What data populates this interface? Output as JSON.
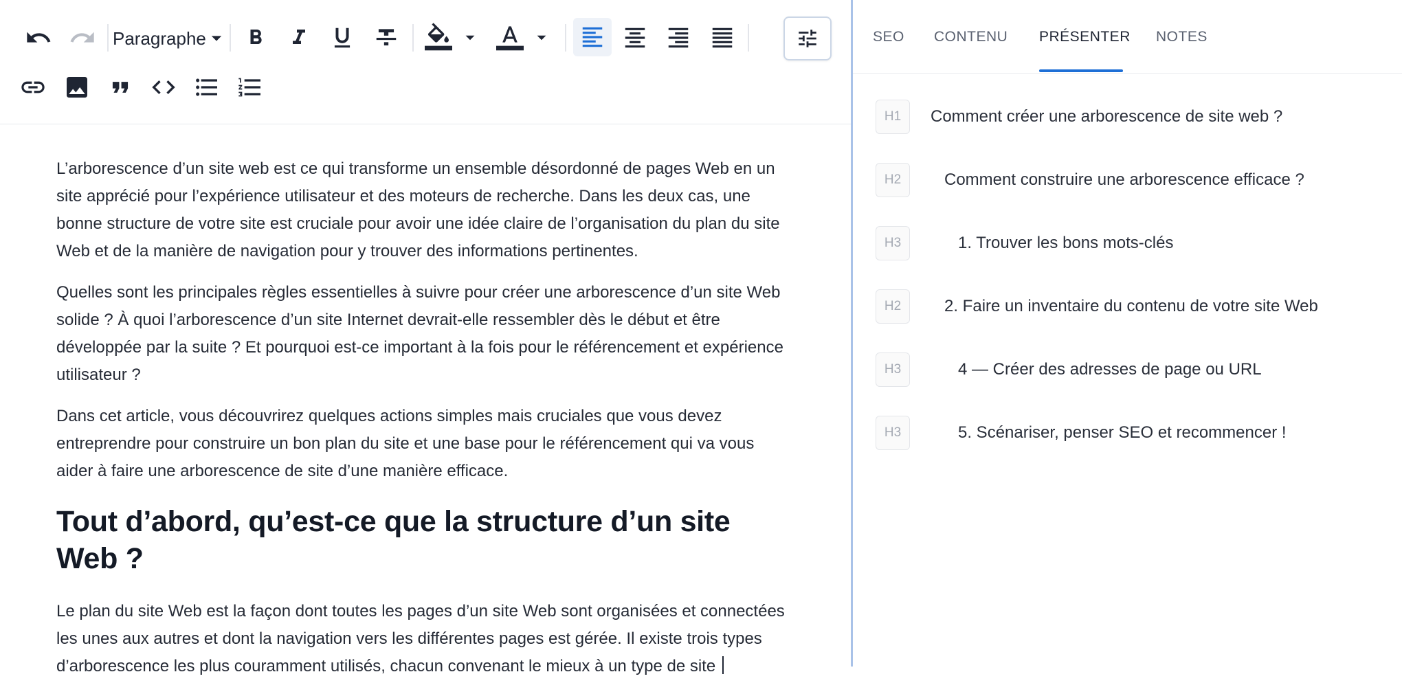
{
  "toolbar": {
    "block_format": "Paragraphe",
    "colors": {
      "highlight_fill": "#1f2533",
      "text_fill": "#1f2533",
      "accent": "#1e6fd6",
      "active_bg": "#eef2f8"
    },
    "icons": [
      "undo-icon",
      "redo-icon",
      "bold-icon",
      "italic-icon",
      "underline-icon",
      "strikethrough-icon",
      "highlight-color-icon",
      "text-color-icon",
      "align-left-icon",
      "align-center-icon",
      "align-right-icon",
      "align-justify-icon",
      "settings-sliders-icon",
      "link-icon",
      "image-icon",
      "quote-icon",
      "code-icon",
      "bullet-list-icon",
      "numbered-list-icon"
    ]
  },
  "editor": {
    "paragraphs": [
      "L’arborescence d’un site web est ce qui transforme un ensemble désordonné de pages Web en un site apprécié pour l’expérience utilisateur et des moteurs de recherche. Dans les deux cas, une bonne structure de votre site est cruciale pour avoir une idée claire de l’organisation du plan du site Web et de la manière de navigation pour y trouver des informations pertinentes.",
      "Quelles sont les principales règles essentielles à suivre pour créer une arborescence d’un site Web solide ? À quoi l’arborescence d’un site Internet devrait-elle ressembler dès le début et être développée par la suite ? Et pourquoi est-ce important à la fois pour le référencement et expérience utilisateur ?",
      "Dans cet article, vous découvrirez quelques actions simples mais cruciales que vous devez entreprendre pour construire un bon plan du site et une base pour le référencement qui va vous aider à faire une arborescence de site d’une manière efficace."
    ],
    "heading": "Tout d’abord, qu’est-ce que la structure d’un site Web ?",
    "last_paragraph": "Le plan du site Web est la façon dont toutes les pages d’un site Web sont organisées et connectées les unes aux autres et dont la navigation vers les différentes pages est gérée. Il existe trois types d’arborescence les plus couramment utilisés, chacun convenant le mieux à un type de site"
  },
  "panel": {
    "tabs": [
      "SEO",
      "CONTENU",
      "PRÉSENTER",
      "NOTES"
    ],
    "active_tab": "PRÉSENTER",
    "outline": [
      {
        "level": "H1",
        "text": "Comment créer une arborescence de site web ?"
      },
      {
        "level": "H2",
        "text": "Comment construire une arborescence efficace ?"
      },
      {
        "level": "H3",
        "text": "1. Trouver les bons mots-clés"
      },
      {
        "level": "H2",
        "text": "2. Faire un inventaire du contenu de votre site Web"
      },
      {
        "level": "H3",
        "text": "4 — Créer des adresses de page ou URL"
      },
      {
        "level": "H3",
        "text": "5. Scénariser, penser SEO et recommencer !"
      }
    ]
  }
}
